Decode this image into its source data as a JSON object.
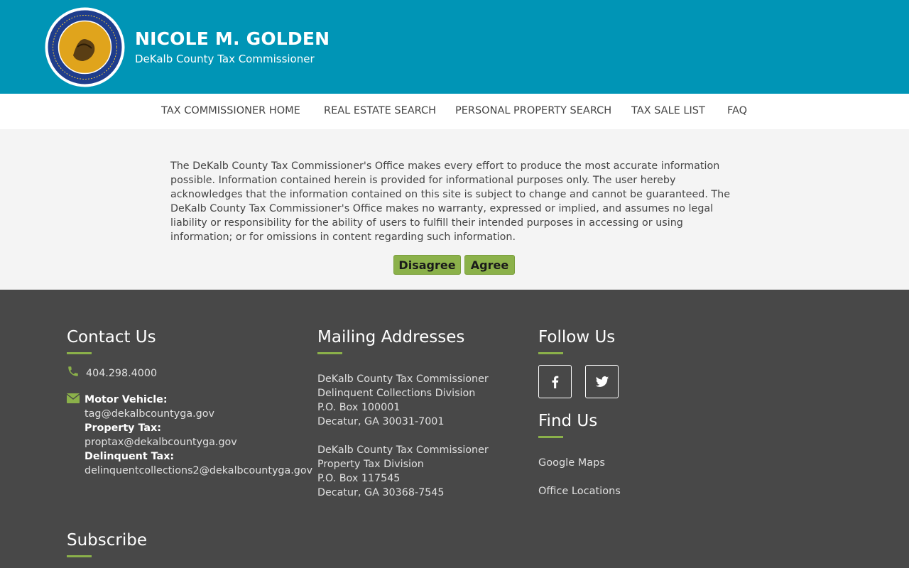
{
  "header": {
    "title": "NICOLE M. GOLDEN",
    "subtitle": "DeKalb County Tax Commissioner",
    "seal_icon": "county-seal-icon"
  },
  "nav": {
    "items": [
      {
        "label": "TAX COMMISSIONER HOME"
      },
      {
        "label": "REAL ESTATE SEARCH"
      },
      {
        "label": "PERSONAL PROPERTY SEARCH"
      },
      {
        "label": "TAX SALE LIST"
      },
      {
        "label": "FAQ"
      }
    ]
  },
  "disclaimer": {
    "text": "The DeKalb County Tax Commissioner's Office makes every effort to produce the most accurate information possible. Information contained herein is provided for informational purposes only. The user hereby acknowledges that the information contained on this site is subject to change and cannot be guaranteed. The DeKalb County Tax Commissioner's Office makes no warranty, expressed or implied, and assumes no legal liability or responsibility for the ability of users to fulfill their intended purposes in accessing or using information; or for omissions in content regarding such information.",
    "disagree_label": "Disagree",
    "agree_label": "Agree"
  },
  "footer": {
    "contact": {
      "heading": "Contact Us",
      "phone": "404.298.4000",
      "emails": [
        {
          "label": "Motor Vehicle:",
          "value": "tag@dekalbcountyga.gov"
        },
        {
          "label": "Property Tax:",
          "value": "proptax@dekalbcountyga.gov"
        },
        {
          "label": "Delinquent Tax:",
          "value": "delinquentcollections2@dekalbcountyga.gov"
        }
      ]
    },
    "mailing": {
      "heading": "Mailing Addresses",
      "addresses": [
        {
          "line1": "DeKalb County Tax Commissioner",
          "line2": "Delinquent Collections Division",
          "line3": "P.O. Box 100001",
          "line4": "Decatur, GA 30031-7001"
        },
        {
          "line1": "DeKalb County Tax Commissioner",
          "line2": "Property Tax Division",
          "line3": "P.O. Box 117545",
          "line4": "Decatur, GA 30368-7545"
        }
      ]
    },
    "follow": {
      "heading": "Follow Us"
    },
    "find": {
      "heading": "Find Us",
      "links": [
        {
          "label": "Google Maps"
        },
        {
          "label": "Office Locations"
        }
      ]
    },
    "subscribe": {
      "heading": "Subscribe"
    }
  },
  "colors": {
    "header_bg": "#0095b6",
    "accent_green": "#8bb14a",
    "footer_bg": "#484848"
  }
}
